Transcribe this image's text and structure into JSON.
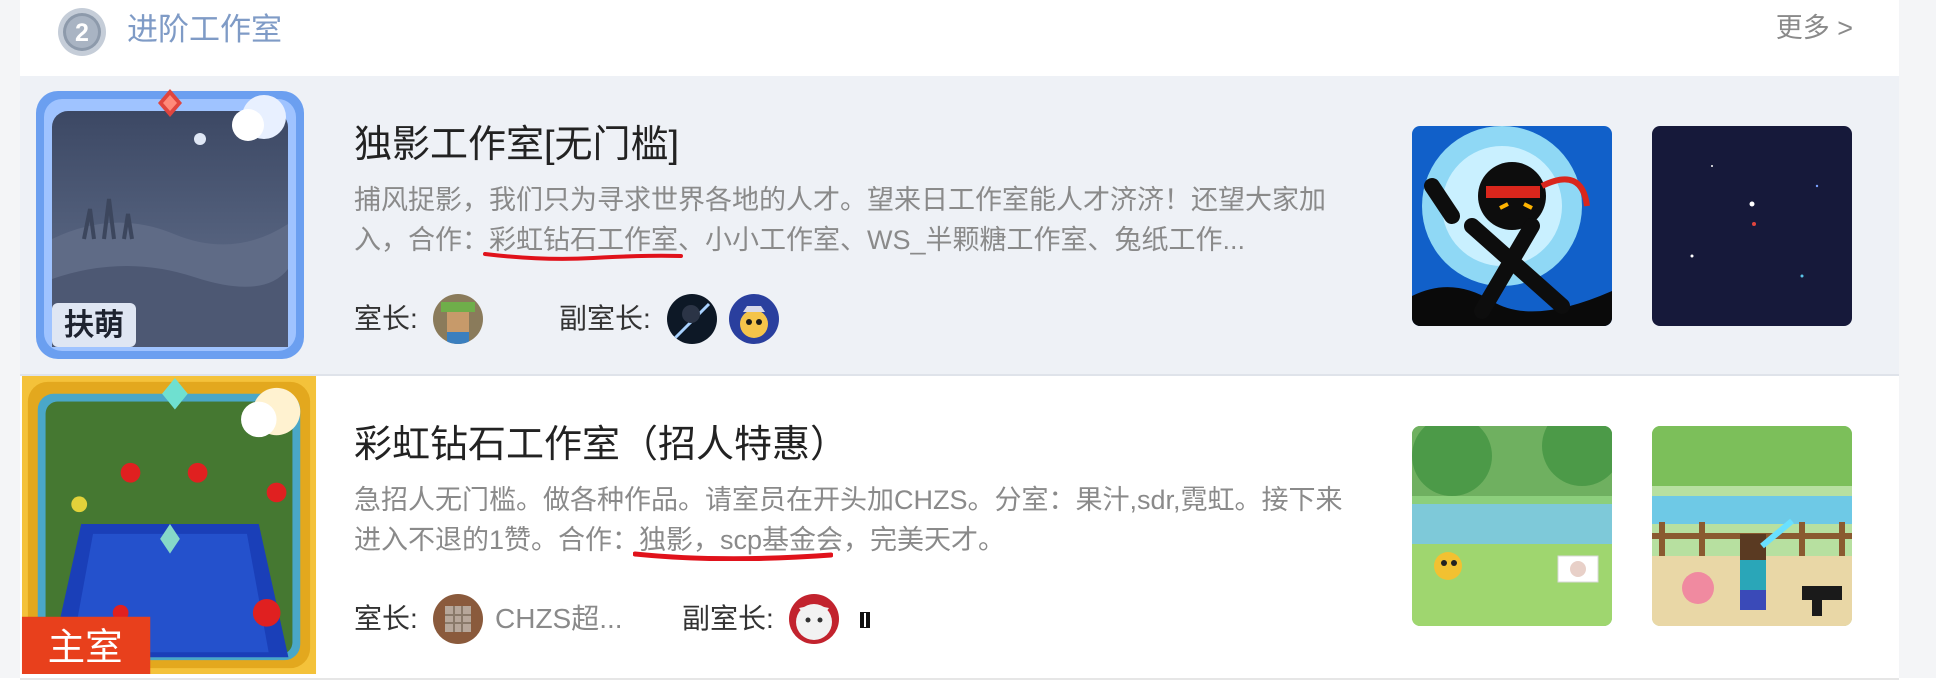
{
  "header": {
    "rank_number": "2",
    "title": "进阶工作室",
    "more_label": "更多 >"
  },
  "studios": [
    {
      "name": "独影工作室[无门槛]",
      "description_before": "捕风捉影，我们只为寻求世界各地的人才。望来日工作室能人才济济！还望大家加入，合作：",
      "description_highlight": "彩虹钻石工作室",
      "description_after": "、小小工作室、WS_半颗糖工作室、兔纸工作...",
      "badge": "扶萌",
      "owner_label": "室长:",
      "vice_label": "副室长:"
    },
    {
      "name": "彩虹钻石工作室（招人特惠）",
      "description_before": "急招人无门槛。做各种作品。请室员在开头加CHZS。分室：果汁,sdr,霓虹。接下来进入不退的1赞。合作：",
      "description_highlight": "独影",
      "description_after": "，scp基金会，完美天才。",
      "badge": "主室",
      "owner_label": "室长:",
      "owner_name": "CHZS超...",
      "vice_label": "副室长:"
    }
  ],
  "colors": {
    "accent": "#7f9bc6",
    "annotation_red": "#e0121b",
    "badge_red": "#e8401c"
  }
}
